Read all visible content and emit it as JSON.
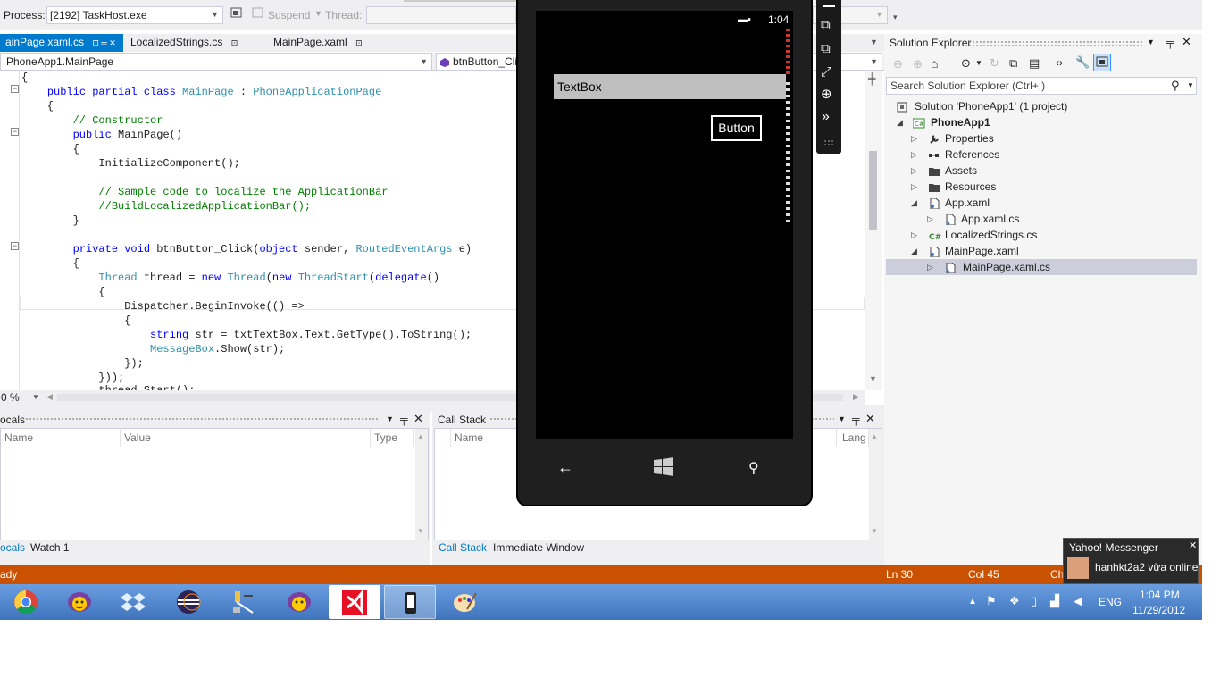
{
  "toolbar": {
    "process_label": "Process:",
    "process_value": "[2192] TaskHost.exe",
    "suspend_label": "Suspend",
    "thread_label": "Thread:"
  },
  "doc_tabs": [
    {
      "label": "ainPage.xaml.cs",
      "active": true
    },
    {
      "label": "LocalizedStrings.cs",
      "active": false
    },
    {
      "label": "MainPage.xaml",
      "active": false
    }
  ],
  "nav": {
    "class_combo": "PhoneApp1.MainPage",
    "member_combo": "btnButton_Cli"
  },
  "code_lines": [
    "{",
    "    public partial class MainPage : PhoneApplicationPage",
    "    {",
    "        // Constructor",
    "        public MainPage()",
    "        {",
    "            InitializeComponent();",
    "",
    "            // Sample code to localize the ApplicationBar",
    "            //BuildLocalizedApplicationBar();",
    "        }",
    "",
    "        private void btnButton_Click(object sender, RoutedEventArgs e)",
    "        {",
    "            Thread thread = new Thread(new ThreadStart(delegate()",
    "            {",
    "                Dispatcher.BeginInvoke(() =>",
    "                {",
    "                    string str = txtTextBox.Text.GetType().ToString();",
    "                    MessageBox.Show(str);",
    "                });",
    "            }));",
    "            thread.Start();"
  ],
  "editor": {
    "zoom": "0 %"
  },
  "locals_panel": {
    "title": "ocals",
    "columns": [
      "Name",
      "Value",
      "Type"
    ],
    "tabs": [
      "ocals",
      "Watch 1"
    ]
  },
  "callstack_panel": {
    "title": "Call Stack",
    "columns": [
      "Name",
      "Lang"
    ],
    "tabs": [
      "Call Stack",
      "Immediate Window"
    ]
  },
  "solution_explorer": {
    "title": "Solution Explorer",
    "search_placeholder": "Search Solution Explorer (Ctrl+;)",
    "items": [
      {
        "label": "Solution 'PhoneApp1' (1 project)",
        "level": 0,
        "expander": "",
        "bold": false
      },
      {
        "label": "PhoneApp1",
        "level": 1,
        "expander": "open",
        "bold": true
      },
      {
        "label": "Properties",
        "level": 2,
        "expander": "closed",
        "bold": false
      },
      {
        "label": "References",
        "level": 2,
        "expander": "closed",
        "bold": false
      },
      {
        "label": "Assets",
        "level": 2,
        "expander": "closed",
        "bold": false
      },
      {
        "label": "Resources",
        "level": 2,
        "expander": "closed",
        "bold": false
      },
      {
        "label": "App.xaml",
        "level": 2,
        "expander": "open",
        "bold": false
      },
      {
        "label": "App.xaml.cs",
        "level": 3,
        "expander": "closed",
        "bold": false
      },
      {
        "label": "LocalizedStrings.cs",
        "level": 2,
        "expander": "closed",
        "bold": false
      },
      {
        "label": "MainPage.xaml",
        "level": 2,
        "expander": "open",
        "bold": false
      },
      {
        "label": "MainPage.xaml.cs",
        "level": 3,
        "expander": "closed",
        "bold": false,
        "selected": true
      }
    ]
  },
  "status_bar": {
    "left": "ady",
    "ln": "Ln 30",
    "col": "Col 45",
    "ch": "Ch"
  },
  "phone": {
    "time": "1:04",
    "textbox_text": "TextBox",
    "button_label": "Button"
  },
  "taskbar": {
    "lang": "ENG",
    "time": "1:04 PM",
    "date": "11/29/2012"
  },
  "yahoo": {
    "title": "Yahoo! Messenger",
    "message": "hanhkt2a2 vừa online"
  },
  "colors": {
    "accent": "#007acc",
    "status_bar": "#ca5100",
    "keyword": "#0000ff",
    "type": "#2b91af",
    "comment": "#008000"
  }
}
